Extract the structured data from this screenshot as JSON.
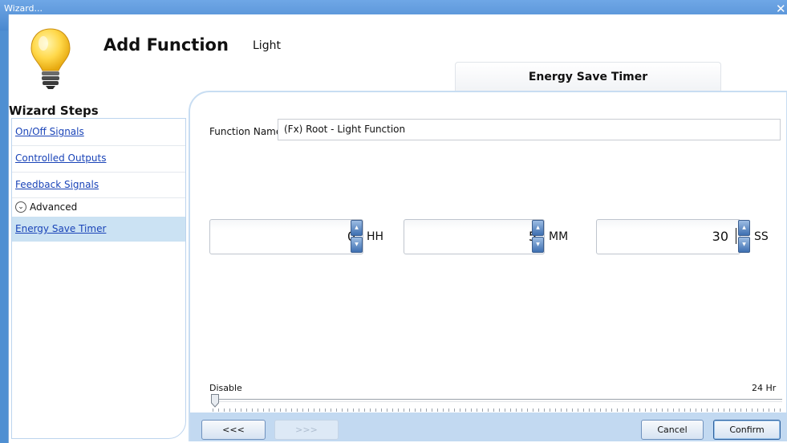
{
  "window": {
    "title": "Wizard...",
    "close_glyph": "✕"
  },
  "header": {
    "title": "Add Function",
    "subtitle": "Light",
    "icon": "lightbulb-icon",
    "step_tab": "Energy Save Timer"
  },
  "sidebar": {
    "heading": "Wizard Steps",
    "items": [
      {
        "label": "On/Off Signals"
      },
      {
        "label": "Controlled Outputs"
      },
      {
        "label": "Feedback Signals"
      }
    ],
    "group_label": "Advanced",
    "group_icon": "chevron-down-icon",
    "active_item": "Energy Save Timer"
  },
  "form": {
    "function_name_label": "Function Name:",
    "function_name_value": "(Fx) Root - Light Function",
    "hours": {
      "value": "0",
      "unit": "HH"
    },
    "minutes": {
      "value": "5",
      "unit": "MM"
    },
    "seconds": {
      "value": "30",
      "unit": "SS"
    },
    "slider": {
      "min_label": "Disable",
      "max_label": "24 Hr",
      "position_fraction": 0.0
    }
  },
  "footer": {
    "back_label": "<<<",
    "next_label": ">>>",
    "cancel_label": "Cancel",
    "confirm_label": "Confirm"
  },
  "colors": {
    "titlebar": "#4a88cf",
    "sidebar_active": "#cbe2f3",
    "link": "#1a44b8",
    "footer_band": "#c2d9f1"
  }
}
